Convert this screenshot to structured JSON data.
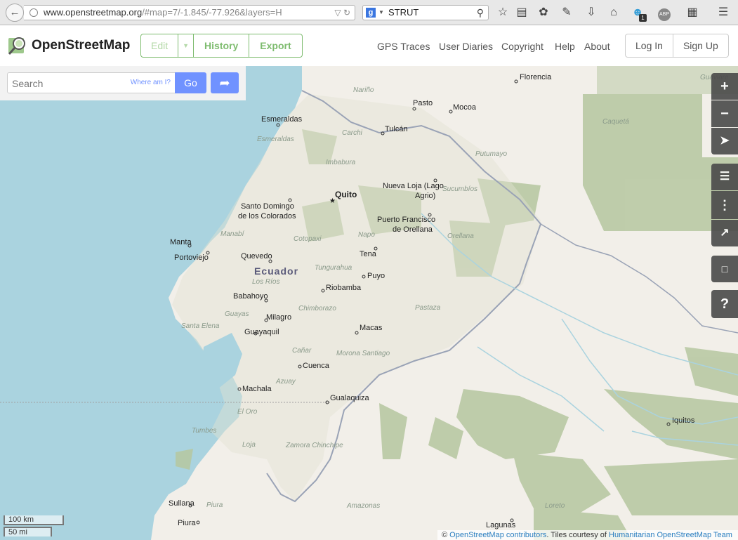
{
  "browser": {
    "url_main": "www.openstreetmap.org",
    "url_rest": "/#map=7/-1.845/-77.926&layers=H",
    "search_engine_letter": "g",
    "search_query": "STRUT",
    "notification_count": "1",
    "abp_label": "ABP"
  },
  "header": {
    "brand": "OpenStreetMap",
    "edit": "Edit",
    "history": "History",
    "export": "Export",
    "nav": [
      "GPS Traces",
      "User Diaries",
      "Copyright",
      "Help",
      "About"
    ],
    "login": "Log In",
    "signup": "Sign Up"
  },
  "search": {
    "placeholder": "Search",
    "where_am_i": "Where am I?",
    "go": "Go"
  },
  "map": {
    "cities": [
      {
        "name": "Florencia",
        "lon": -75.61,
        "lat": 1.61
      },
      {
        "name": "Pasto",
        "lon": -77.28,
        "lat": 1.21
      },
      {
        "name": "Mocoa",
        "lon": -76.65,
        "lat": 1.15
      },
      {
        "name": "Tulcán",
        "lon": -77.72,
        "lat": 0.81
      },
      {
        "name": "Esmeraldas",
        "lon": -79.65,
        "lat": 0.97
      },
      {
        "name": "Nueva Loja (Lago",
        "lon": -76.89,
        "lat": 0.09
      },
      {
        "name": "Agrio)",
        "lon": -76.89,
        "lat": 0.09
      },
      {
        "name": "Quito",
        "lon": -78.47,
        "lat": -0.18
      },
      {
        "name": "Santo Domingo",
        "lon": -79.17,
        "lat": -0.25
      },
      {
        "name": "de los Colorados",
        "lon": -79.17,
        "lat": -0.25
      },
      {
        "name": "Puerto Francisco",
        "lon": -76.98,
        "lat": -0.46
      },
      {
        "name": "de Orellana",
        "lon": -76.98,
        "lat": -0.46
      },
      {
        "name": "Manta",
        "lon": -80.71,
        "lat": -0.95
      },
      {
        "name": "Portoviejo",
        "lon": -80.45,
        "lat": -1.06
      },
      {
        "name": "Quevedo",
        "lon": -79.46,
        "lat": -1.02
      },
      {
        "name": "Tena",
        "lon": -77.81,
        "lat": -0.99
      },
      {
        "name": "Puyo",
        "lon": -78.0,
        "lat": -1.49
      },
      {
        "name": "Riobamba",
        "lon": -78.65,
        "lat": -1.67
      },
      {
        "name": "Babahoyo",
        "lon": -79.53,
        "lat": -1.8
      },
      {
        "name": "Milagro",
        "lon": -79.59,
        "lat": -2.13
      },
      {
        "name": "Guayaquil",
        "lon": -79.9,
        "lat": -2.19
      },
      {
        "name": "Macas",
        "lon": -78.12,
        "lat": -2.31
      },
      {
        "name": "Cuenca",
        "lon": -79.0,
        "lat": -2.9
      },
      {
        "name": "Machala",
        "lon": -79.96,
        "lat": -3.26
      },
      {
        "name": "Gualaquiza",
        "lon": -78.57,
        "lat": -3.4
      },
      {
        "name": "Iquitos",
        "lon": -73.25,
        "lat": -3.75
      },
      {
        "name": "Sullana",
        "lon": -80.69,
        "lat": -4.9
      },
      {
        "name": "Piura",
        "lon": -80.63,
        "lat": -5.19
      },
      {
        "name": "Lagunas",
        "lon": -75.67,
        "lat": -5.23
      }
    ],
    "country_label": "Ecuador",
    "regions": [
      "Nariño",
      "Carchi",
      "Esmeraldas",
      "Imbabura",
      "Sucumbíos",
      "Putumayo",
      "Caquetá",
      "Guaviare",
      "Manabí",
      "Cotopaxi",
      "Napo",
      "Orellana",
      "Tungurahua",
      "Los Ríos",
      "Guayas",
      "Chimborazo",
      "Pastaza",
      "Santa Elena",
      "Cañar",
      "Morona Santiago",
      "Azuay",
      "El Oro",
      "Tumbes",
      "Loja",
      "Zamora Chinchipe",
      "Piura",
      "Amazonas",
      "Loreto"
    ]
  },
  "scale": {
    "km": "100 km",
    "mi": "50 mi"
  },
  "attribution": {
    "prefix": "©",
    "osm": "OpenStreetMap contributors",
    "mid": ". Tiles courtesy of",
    "hot": "Humanitarian OpenStreetMap Team"
  },
  "colors": {
    "water": "#aad3df",
    "land": "#f2efe9",
    "forest": "#b6c7a0",
    "accent": "#7ebc6f",
    "button": "#7092ff"
  }
}
